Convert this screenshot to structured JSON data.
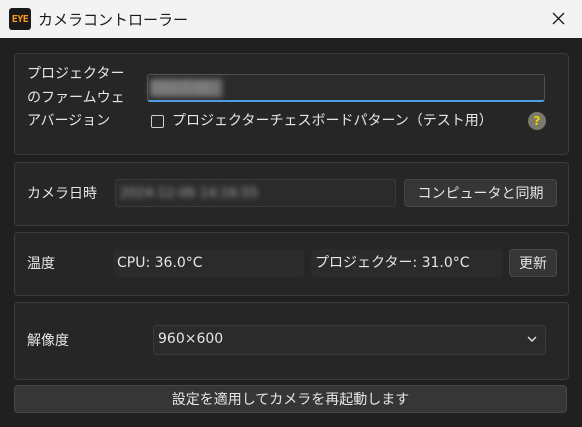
{
  "window": {
    "title": "カメラコントローラー",
    "icon_text": "EYE"
  },
  "firmware": {
    "label": "プロジェクターのファームウェアバージョン",
    "value": "ESO-T.40",
    "checkbox_label": "プロジェクターチェスボードパターン（テスト用）",
    "checkbox_checked": false,
    "help": "?"
  },
  "camera_time": {
    "label": "カメラ日時",
    "value": "2024-12-06 14:16:55",
    "sync_button": "コンピュータと同期"
  },
  "temperature": {
    "label": "温度",
    "cpu": "CPU: 36.0°C",
    "projector": "プロジェクター:  31.0°C",
    "refresh_button": "更新"
  },
  "resolution": {
    "label": "解像度",
    "selected": "960×600"
  },
  "apply_button": "設定を適用してカメラを再起動します",
  "colors": {
    "accent": "#4e9be6",
    "background": "#202020",
    "titlebar": "#f3f3f3"
  }
}
